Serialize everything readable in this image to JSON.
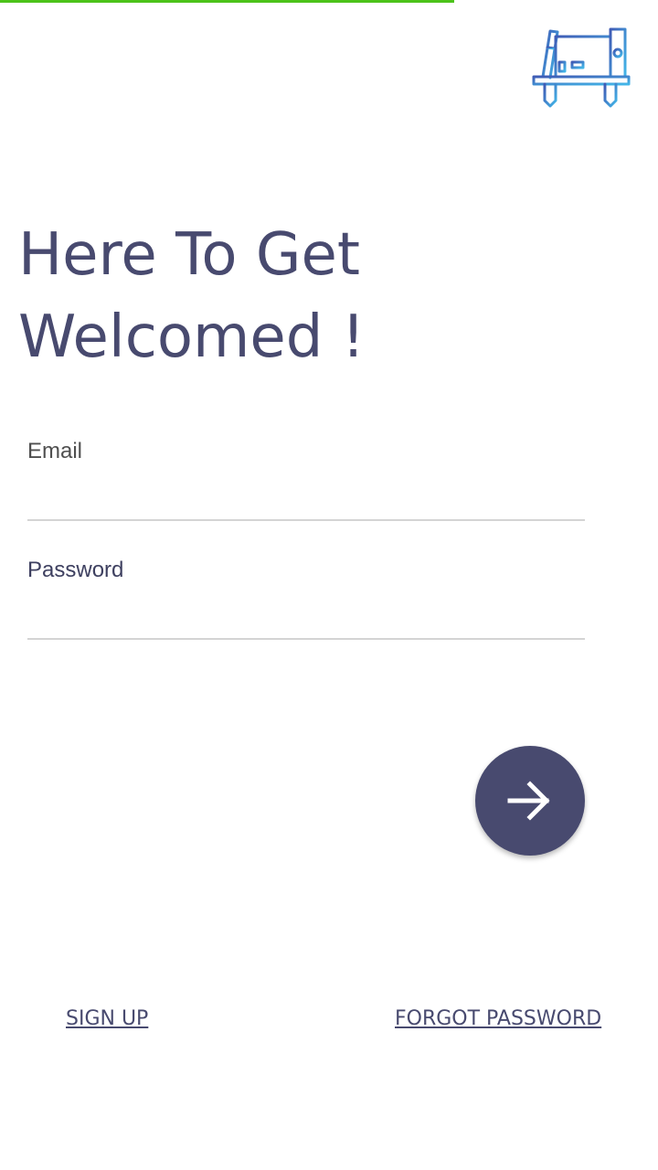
{
  "progress": {
    "fraction": 0.69,
    "color": "#4cc31a"
  },
  "logo": {
    "icon": "bookshelf-icon"
  },
  "headline": {
    "line1": "Here To Get",
    "line2": "Welcomed !"
  },
  "form": {
    "email": {
      "label": "Email",
      "value": ""
    },
    "password": {
      "label": "Password",
      "value": ""
    },
    "submit": {
      "icon": "arrow-right-icon"
    }
  },
  "links": {
    "signup": "SIGN UP",
    "forgot": "FORGOT PASSWORD"
  },
  "colors": {
    "primary": "#484a6f",
    "progress": "#4cc31a",
    "input_underline": "#d4d4d4"
  }
}
